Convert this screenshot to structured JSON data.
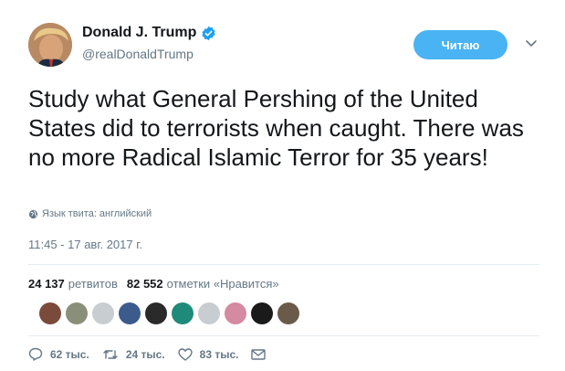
{
  "user": {
    "name": "Donald J. Trump",
    "handle": "@realDonaldTrump",
    "verified": true
  },
  "follow_button_label": "Читаю",
  "tweet": {
    "text": "Study what General Pershing of the United States did to terrorists when caught. There was no more Radical Islamic Terror for 35 years!",
    "language_note": "Язык твита: английский",
    "timestamp": "11:45 - 17 авг. 2017 г."
  },
  "stats": {
    "retweets_count": "24 137",
    "retweets_label": "ретвитов",
    "likes_count": "82 552",
    "likes_label": "отметки «Нравится»"
  },
  "likers": [
    {
      "color": "#7a4a3a"
    },
    {
      "color": "#8a8f7a"
    },
    {
      "color": "#c8cdd1"
    },
    {
      "color": "#3b5b8c"
    },
    {
      "color": "#2a2a2a"
    },
    {
      "color": "#1f8a7a"
    },
    {
      "color": "#c8cdd1"
    },
    {
      "color": "#d48aa0"
    },
    {
      "color": "#1a1a1a"
    },
    {
      "color": "#6a5a4a"
    }
  ],
  "actions": {
    "replies": "62 тыс.",
    "retweets": "24 тыс.",
    "likes": "83 тыс."
  },
  "colors": {
    "accent": "#4ab3f4",
    "verified": "#1da1f2",
    "secondary_text": "#657786"
  }
}
